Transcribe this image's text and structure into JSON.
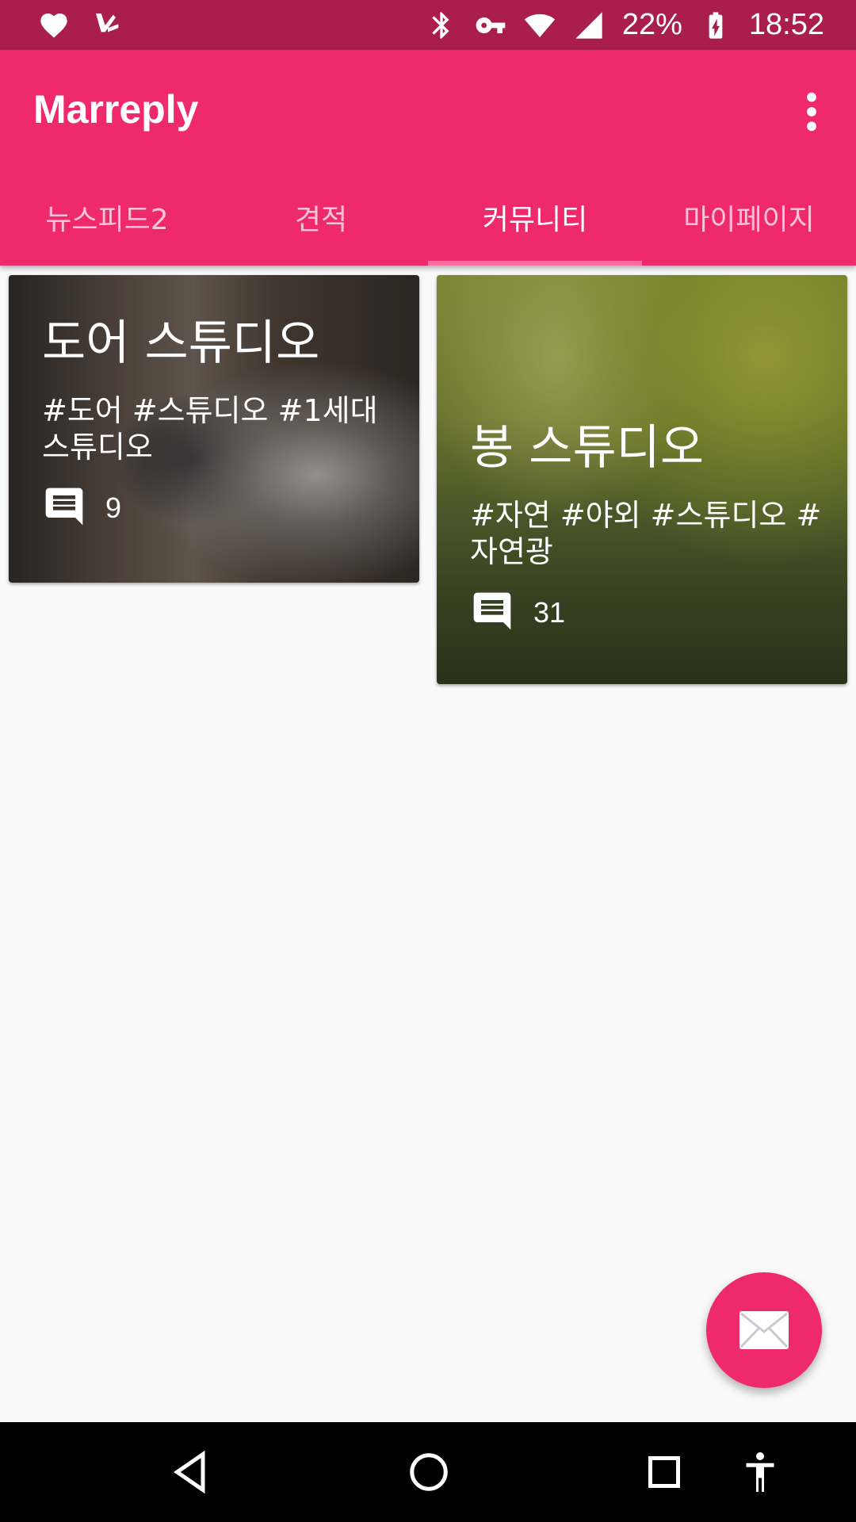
{
  "status_bar": {
    "battery": "22%",
    "time": "18:52",
    "icons": [
      "heart-icon",
      "check-tag-icon",
      "bluetooth-icon",
      "vpn-key-icon",
      "wifi-icon",
      "cell-signal-icon",
      "battery-charging-icon"
    ]
  },
  "app_bar": {
    "title": "Marreply",
    "menu_icon": "more-vert-icon"
  },
  "tabs": [
    {
      "label": "뉴스피드2",
      "active": false
    },
    {
      "label": "견적",
      "active": false
    },
    {
      "label": "커뮤니티",
      "active": true
    },
    {
      "label": "마이페이지",
      "active": false
    }
  ],
  "cards": [
    {
      "title": "도어 스튜디오",
      "tags": "#도어 #스튜디오 #1세대 스튜디오",
      "comments": "9",
      "image": "wedding-couple-indoor-photo"
    },
    {
      "title": "봉 스튜디오",
      "tags": "#자연 #야외 #스튜디오 #자연광",
      "comments": "31",
      "image": "wedding-couple-outdoor-photo"
    }
  ],
  "fab": {
    "icon": "mail-icon",
    "color": "#ef2a6c"
  },
  "colors": {
    "primary": "#ef2a6c",
    "primary_dark": "#a91e4d",
    "tab_indicator": "#ff6f9c"
  }
}
